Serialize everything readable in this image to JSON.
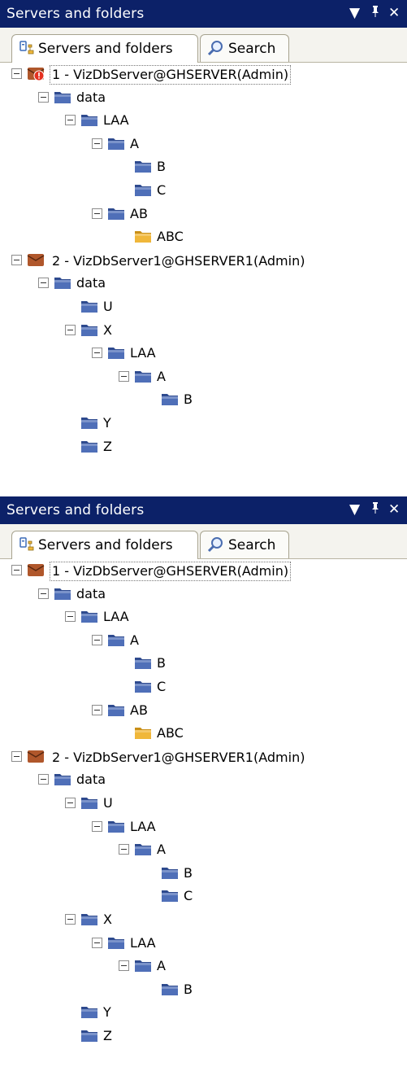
{
  "panels": [
    {
      "title": "Servers and folders",
      "controls": {
        "dropdown": "▼",
        "pin": "ᵖ",
        "close": "✕"
      },
      "tabs": [
        {
          "label": "Servers and folders",
          "icon": "servers-folders-icon",
          "active": true
        },
        {
          "label": "Search",
          "icon": "magnifier-search-icon",
          "active": false
        }
      ],
      "tree": [
        {
          "id": "p1r0",
          "label": "1 - VizDbServer@GHSERVER(Admin)",
          "type": "server-error",
          "expanded": true,
          "level": 0,
          "selected": true
        },
        {
          "id": "p1r1",
          "label": "data",
          "type": "folder",
          "expanded": true,
          "level": 1
        },
        {
          "id": "p1r2",
          "label": "LAA",
          "type": "folder",
          "expanded": true,
          "level": 2
        },
        {
          "id": "p1r3",
          "label": "A",
          "type": "folder",
          "expanded": true,
          "level": 3
        },
        {
          "id": "p1r4",
          "label": "B",
          "type": "folder",
          "expanded": null,
          "level": 4
        },
        {
          "id": "p1r5",
          "label": "C",
          "type": "folder",
          "expanded": null,
          "level": 4
        },
        {
          "id": "p1r6",
          "label": "AB",
          "type": "folder",
          "expanded": true,
          "level": 3
        },
        {
          "id": "p1r7",
          "label": "ABC",
          "type": "folder-yellow",
          "expanded": null,
          "level": 4
        },
        {
          "id": "p1r8",
          "label": "2 - VizDbServer1@GHSERVER1(Admin)",
          "type": "server",
          "expanded": true,
          "level": 0
        },
        {
          "id": "p1r9",
          "label": "data",
          "type": "folder",
          "expanded": true,
          "level": 1
        },
        {
          "id": "p1r10",
          "label": "U",
          "type": "folder",
          "expanded": null,
          "level": 2
        },
        {
          "id": "p1r11",
          "label": "X",
          "type": "folder",
          "expanded": true,
          "level": 2
        },
        {
          "id": "p1r12",
          "label": "LAA",
          "type": "folder",
          "expanded": true,
          "level": 3
        },
        {
          "id": "p1r13",
          "label": "A",
          "type": "folder",
          "expanded": true,
          "level": 4
        },
        {
          "id": "p1r14",
          "label": "B",
          "type": "folder",
          "expanded": null,
          "level": 5
        },
        {
          "id": "p1r15",
          "label": "Y",
          "type": "folder",
          "expanded": null,
          "level": 2
        },
        {
          "id": "p1r16",
          "label": "Z",
          "type": "folder",
          "expanded": null,
          "level": 2
        }
      ]
    },
    {
      "title": "Servers and folders",
      "controls": {
        "dropdown": "▼",
        "pin": "ᵖ",
        "close": "✕"
      },
      "tabs": [
        {
          "label": "Servers and folders",
          "icon": "servers-folders-icon",
          "active": true
        },
        {
          "label": "Search",
          "icon": "magnifier-search-icon",
          "active": false
        }
      ],
      "tree": [
        {
          "id": "p2r0",
          "label": "1 - VizDbServer@GHSERVER(Admin)",
          "type": "server",
          "expanded": true,
          "level": 0,
          "selected": true
        },
        {
          "id": "p2r1",
          "label": "data",
          "type": "folder",
          "expanded": true,
          "level": 1
        },
        {
          "id": "p2r2",
          "label": "LAA",
          "type": "folder",
          "expanded": true,
          "level": 2
        },
        {
          "id": "p2r3",
          "label": "A",
          "type": "folder",
          "expanded": true,
          "level": 3
        },
        {
          "id": "p2r4",
          "label": "B",
          "type": "folder",
          "expanded": null,
          "level": 4
        },
        {
          "id": "p2r5",
          "label": "C",
          "type": "folder",
          "expanded": null,
          "level": 4
        },
        {
          "id": "p2r6",
          "label": "AB",
          "type": "folder",
          "expanded": true,
          "level": 3
        },
        {
          "id": "p2r7",
          "label": "ABC",
          "type": "folder-yellow",
          "expanded": null,
          "level": 4
        },
        {
          "id": "p2r8",
          "label": "2 - VizDbServer1@GHSERVER1(Admin)",
          "type": "server",
          "expanded": true,
          "level": 0
        },
        {
          "id": "p2r9",
          "label": "data",
          "type": "folder",
          "expanded": true,
          "level": 1
        },
        {
          "id": "p2r10",
          "label": "U",
          "type": "folder",
          "expanded": true,
          "level": 2
        },
        {
          "id": "p2r11",
          "label": "LAA",
          "type": "folder",
          "expanded": true,
          "level": 3
        },
        {
          "id": "p2r12",
          "label": "A",
          "type": "folder",
          "expanded": true,
          "level": 4
        },
        {
          "id": "p2r13",
          "label": "B",
          "type": "folder",
          "expanded": null,
          "level": 5
        },
        {
          "id": "p2r14",
          "label": "C",
          "type": "folder",
          "expanded": null,
          "level": 5
        },
        {
          "id": "p2r15",
          "label": "X",
          "type": "folder",
          "expanded": true,
          "level": 2
        },
        {
          "id": "p2r16",
          "label": "LAA",
          "type": "folder",
          "expanded": true,
          "level": 3
        },
        {
          "id": "p2r17",
          "label": "A",
          "type": "folder",
          "expanded": true,
          "level": 4
        },
        {
          "id": "p2r18",
          "label": "B",
          "type": "folder",
          "expanded": null,
          "level": 5
        },
        {
          "id": "p2r19",
          "label": "Y",
          "type": "folder",
          "expanded": null,
          "level": 2
        },
        {
          "id": "p2r20",
          "label": "Z",
          "type": "folder",
          "expanded": null,
          "level": 2
        }
      ]
    }
  ],
  "colors": {
    "titlebar": "#0c2168",
    "folder_blue": "#4f6fb8",
    "folder_yellow": "#f0b73a",
    "server_brown": "#b0572b",
    "server_error": "#e5301f"
  }
}
